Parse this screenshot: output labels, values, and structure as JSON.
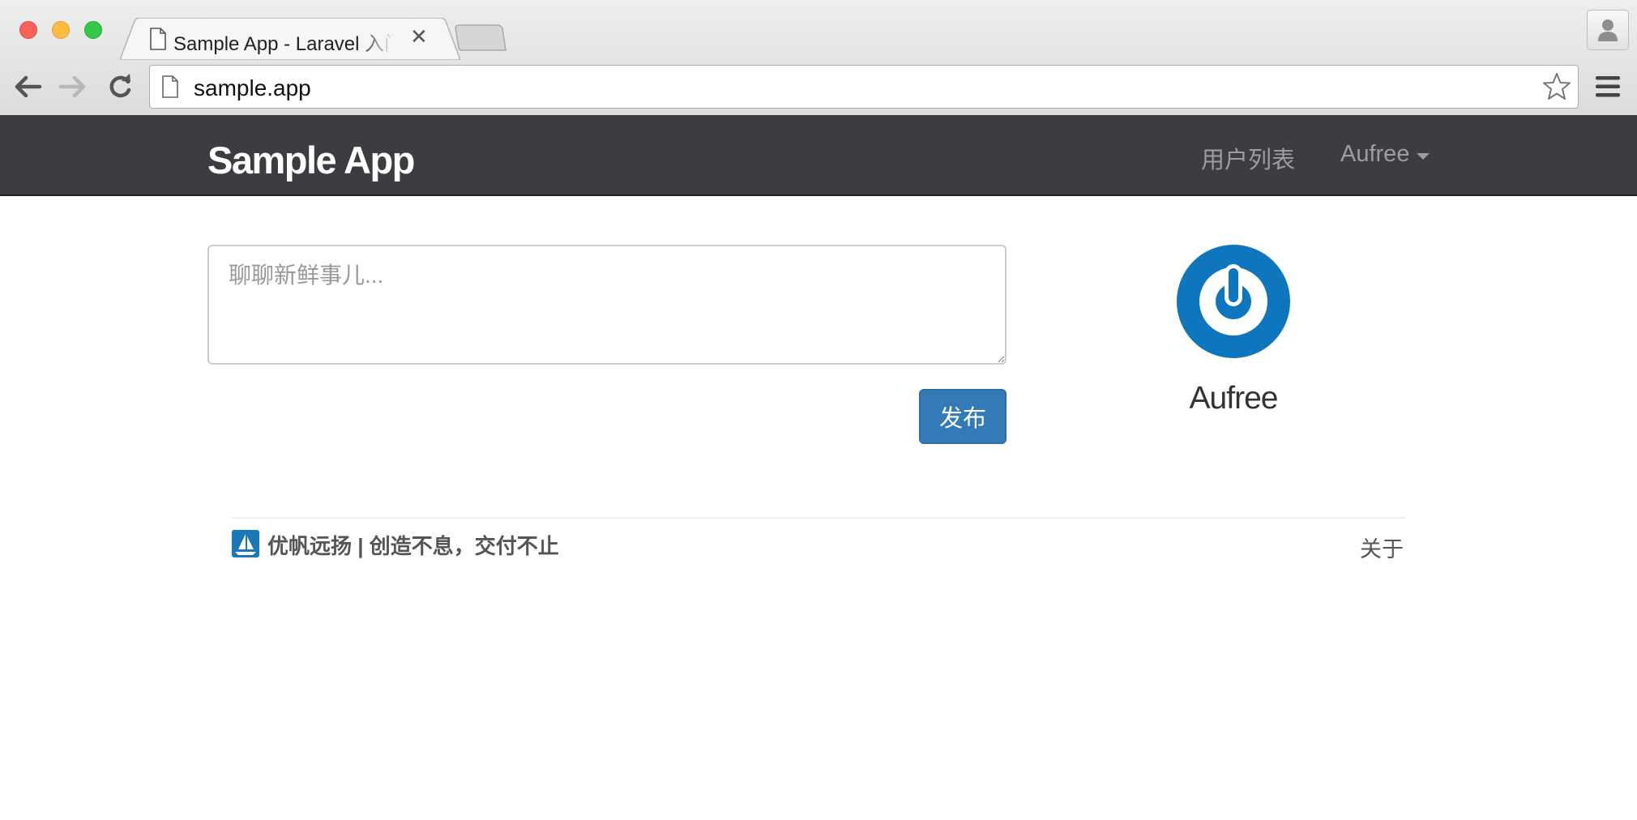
{
  "window": {
    "tab_title": "Sample App - Laravel 入门教程",
    "tab_close_glyph": "✕",
    "address": "sample.app",
    "icons": [
      "close-light",
      "minimize-light",
      "zoom-light",
      "page-icon",
      "back-arrow-icon",
      "forward-arrow-icon",
      "reload-icon",
      "star-icon",
      "menu-icon",
      "profile-icon"
    ],
    "colors": {
      "close": "#fc605b",
      "minimize": "#fdbc40",
      "zoom": "#34c84a"
    }
  },
  "navbar": {
    "brand": "Sample App",
    "links": [
      {
        "label": "用户列表"
      },
      {
        "label": "Aufree",
        "dropdown": true
      }
    ],
    "background": "#3c3d41"
  },
  "composer": {
    "placeholder": "聊聊新鲜事儿...",
    "value": "",
    "submit_label": "发布",
    "submit_color": "#337ab7"
  },
  "profile": {
    "name": "Aufree",
    "avatar_icon": "gravatar-power-icon",
    "avatar_color": "#0e76bd"
  },
  "footer": {
    "brand_text": "优帆远扬 | 创造不息，交付不止",
    "logo_icon": "sailboat-icon",
    "links": [
      "关于"
    ]
  }
}
